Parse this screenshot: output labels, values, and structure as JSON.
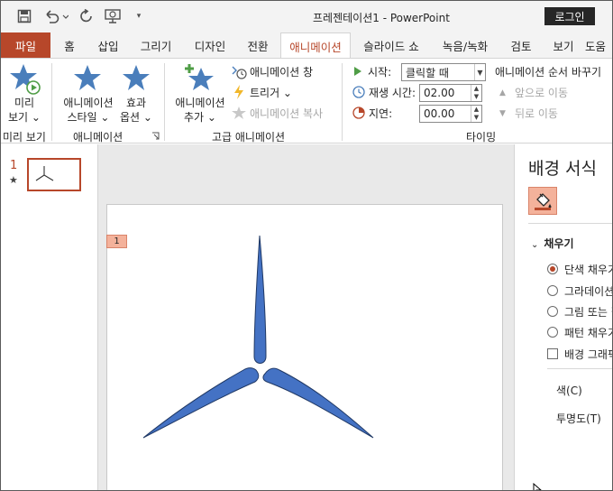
{
  "titlebar": {
    "document_title": "프레젠테이션1  -  PowerPoint",
    "login_label": "로그인",
    "quick_access": [
      "save-icon",
      "undo-icon",
      "redo-icon",
      "present-from-beginning-icon",
      "customize-qat-icon"
    ]
  },
  "tabs": [
    {
      "label": "파일"
    },
    {
      "label": "홈"
    },
    {
      "label": "삽입"
    },
    {
      "label": "그리기"
    },
    {
      "label": "디자인"
    },
    {
      "label": "전환"
    },
    {
      "label": "애니메이션"
    },
    {
      "label": "슬라이드 쇼"
    },
    {
      "label": "녹음/녹화"
    },
    {
      "label": "검토"
    },
    {
      "label": "보기"
    },
    {
      "label": "도움"
    }
  ],
  "ribbon": {
    "preview": {
      "line1": "미리",
      "line2": "보기 ⌄",
      "group": "미리 보기"
    },
    "animation": {
      "styles_line1": "애니메이션",
      "styles_line2": "스타일 ⌄",
      "effects_line1": "효과",
      "effects_line2": "옵션 ⌄",
      "group": "애니메이션"
    },
    "advanced": {
      "add_line1": "애니메이션",
      "add_line2": "추가 ⌄",
      "pane": "애니메이션 창",
      "trigger": "트리거 ⌄",
      "painter": "애니메이션 복사",
      "group": "고급 애니메이션"
    },
    "timing": {
      "start_label": "시작:",
      "start_value": "클릭할 때",
      "duration_label": "재생 시간:",
      "duration_value": "02.00",
      "delay_label": "지연:",
      "delay_value": "00.00",
      "reorder_title": "애니메이션 순서 바꾸기",
      "move_earlier": "앞으로 이동",
      "move_later": "뒤로 이동",
      "group": "타이밍"
    }
  },
  "thumbnails": {
    "slide_number": "1",
    "anim_marker": "★"
  },
  "slide": {
    "animation_tag": "1"
  },
  "format_pane": {
    "title": "배경 서식",
    "section": "채우기",
    "options": [
      {
        "label": "단색 채우기",
        "checked": true
      },
      {
        "label": "그라데이션 채우기",
        "checked": false
      },
      {
        "label": "그림 또는 질감 채우기",
        "checked": false
      },
      {
        "label": "패턴 채우기",
        "checked": false
      }
    ],
    "hide_background_label": "배경 그래픽 숨기기",
    "color_label": "색(C)",
    "transparency_label": "투명도(T)"
  },
  "colors": {
    "accent": "#b7472a",
    "shape_fill": "#4472c4",
    "shape_outline": "#1f3864",
    "star_blue": "#4a7ebb"
  }
}
